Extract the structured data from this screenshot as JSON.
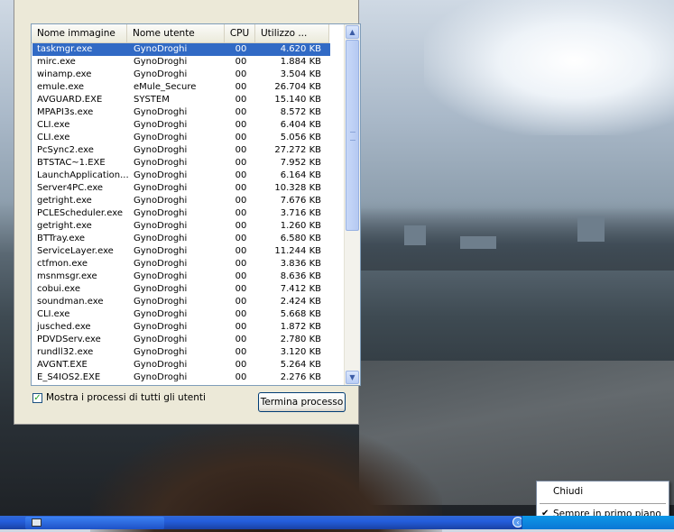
{
  "listview": {
    "columns": [
      "Nome immagine",
      "Nome utente",
      "CPU",
      "Utilizzo ..."
    ],
    "rows": [
      {
        "name": "taskmgr.exe",
        "user": "GynoDroghi",
        "cpu": "00",
        "mem": "4.620 KB"
      },
      {
        "name": "mirc.exe",
        "user": "GynoDroghi",
        "cpu": "00",
        "mem": "1.884 KB"
      },
      {
        "name": "winamp.exe",
        "user": "GynoDroghi",
        "cpu": "00",
        "mem": "3.504 KB"
      },
      {
        "name": "emule.exe",
        "user": "eMule_Secure",
        "cpu": "00",
        "mem": "26.704 KB"
      },
      {
        "name": "AVGUARD.EXE",
        "user": "SYSTEM",
        "cpu": "00",
        "mem": "15.140 KB"
      },
      {
        "name": "MPAPI3s.exe",
        "user": "GynoDroghi",
        "cpu": "00",
        "mem": "8.572 KB"
      },
      {
        "name": "CLI.exe",
        "user": "GynoDroghi",
        "cpu": "00",
        "mem": "6.404 KB"
      },
      {
        "name": "CLI.exe",
        "user": "GynoDroghi",
        "cpu": "00",
        "mem": "5.056 KB"
      },
      {
        "name": "PcSync2.exe",
        "user": "GynoDroghi",
        "cpu": "00",
        "mem": "27.272 KB"
      },
      {
        "name": "BTSTAC~1.EXE",
        "user": "GynoDroghi",
        "cpu": "00",
        "mem": "7.952 KB"
      },
      {
        "name": "LaunchApplication...",
        "user": "GynoDroghi",
        "cpu": "00",
        "mem": "6.164 KB"
      },
      {
        "name": "Server4PC.exe",
        "user": "GynoDroghi",
        "cpu": "00",
        "mem": "10.328 KB"
      },
      {
        "name": "getright.exe",
        "user": "GynoDroghi",
        "cpu": "00",
        "mem": "7.676 KB"
      },
      {
        "name": "PCLEScheduler.exe",
        "user": "GynoDroghi",
        "cpu": "00",
        "mem": "3.716 KB"
      },
      {
        "name": "getright.exe",
        "user": "GynoDroghi",
        "cpu": "00",
        "mem": "1.260 KB"
      },
      {
        "name": "BTTray.exe",
        "user": "GynoDroghi",
        "cpu": "00",
        "mem": "6.580 KB"
      },
      {
        "name": "ServiceLayer.exe",
        "user": "GynoDroghi",
        "cpu": "00",
        "mem": "11.244 KB"
      },
      {
        "name": "ctfmon.exe",
        "user": "GynoDroghi",
        "cpu": "00",
        "mem": "3.836 KB"
      },
      {
        "name": "msnmsgr.exe",
        "user": "GynoDroghi",
        "cpu": "00",
        "mem": "8.636 KB"
      },
      {
        "name": "cobui.exe",
        "user": "GynoDroghi",
        "cpu": "00",
        "mem": "7.412 KB"
      },
      {
        "name": "soundman.exe",
        "user": "GynoDroghi",
        "cpu": "00",
        "mem": "2.424 KB"
      },
      {
        "name": "CLI.exe",
        "user": "GynoDroghi",
        "cpu": "00",
        "mem": "5.668 KB"
      },
      {
        "name": "jusched.exe",
        "user": "GynoDroghi",
        "cpu": "00",
        "mem": "1.872 KB"
      },
      {
        "name": "PDVDServ.exe",
        "user": "GynoDroghi",
        "cpu": "00",
        "mem": "2.780 KB"
      },
      {
        "name": "rundll32.exe",
        "user": "GynoDroghi",
        "cpu": "00",
        "mem": "3.120 KB"
      },
      {
        "name": "AVGNT.EXE",
        "user": "GynoDroghi",
        "cpu": "00",
        "mem": "5.264 KB"
      },
      {
        "name": "E_S4IOS2.EXE",
        "user": "GynoDroghi",
        "cpu": "00",
        "mem": "2.276 KB"
      }
    ],
    "selected_index": 0
  },
  "footer": {
    "show_all_label": "Mostra i processi di tutti gli utenti",
    "show_all_checked": true,
    "end_process_label": "Termina processo"
  },
  "context_menu": {
    "items": [
      {
        "label": "Chiudi"
      },
      {
        "label": "Sempre in primo piano",
        "checked": true
      }
    ]
  },
  "colors": {
    "selection": "#316ac5",
    "taskbar": "#245edc",
    "window_face": "#ece9d8"
  },
  "icons": [
    "chevron-up-icon",
    "chevron-down-icon",
    "checkmark-icon",
    "tray-expand-icon",
    "taskbar-app-icon"
  ]
}
